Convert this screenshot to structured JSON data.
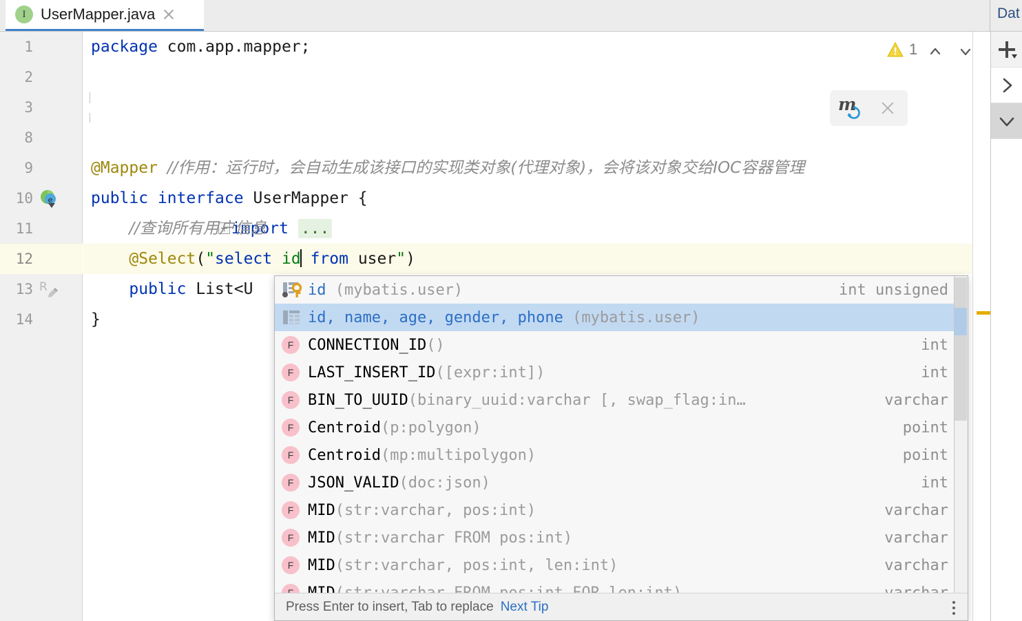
{
  "window": {
    "tab": {
      "icon": "java-interface-icon",
      "title": "UserMapper.java",
      "close_label": "×"
    },
    "right_panel_tab": "Dat"
  },
  "inspection": {
    "warning_icon": "warning-triangle-icon",
    "warning_count": "1",
    "prev_label": "˄",
    "next_label": "˅"
  },
  "mybatis_hint": {
    "logo": "mybatis-logo-icon",
    "close_label": "×"
  },
  "toolstrip": {
    "buttons": [
      {
        "name": "add-button",
        "glyph": "+"
      },
      {
        "name": "expand-right-button",
        "glyph": "›"
      },
      {
        "name": "collapse-down-button",
        "glyph": "⌄"
      }
    ]
  },
  "editor": {
    "lines": [
      {
        "num": "1",
        "marker": "",
        "highlight": false
      },
      {
        "num": "2",
        "marker": "",
        "highlight": false
      },
      {
        "num": "3",
        "marker": "",
        "highlight": false
      },
      {
        "num": "8",
        "marker": "",
        "highlight": false
      },
      {
        "num": "9",
        "marker": "",
        "highlight": false
      },
      {
        "num": "10",
        "marker": "implemented-interface-icon",
        "highlight": false
      },
      {
        "num": "11",
        "marker": "",
        "highlight": false
      },
      {
        "num": "12",
        "marker": "",
        "highlight": true
      },
      {
        "num": "13",
        "marker": "recorder-edit-icon",
        "highlight": false
      },
      {
        "num": "14",
        "marker": "",
        "highlight": false
      }
    ],
    "code": {
      "l1_kw": "package",
      "l1_rest": " com.app.mapper;",
      "l3_kw": "import",
      "l3_fold": "...",
      "l9_anno": "@Mapper",
      "l9_comment": "//作用：运行时，会自动生成该接口的实现类对象(代理对象)，会将该对象交给IOC容器管理",
      "l10_kw1": "public",
      "l10_kw2": "interface",
      "l10_name": "UserMapper",
      "l10_brace": "{",
      "l11_comment": "//查询所有用户信息",
      "l12_anno": "@Select",
      "l12_open": "(",
      "l12_q1": "\"",
      "l12_sel": "select",
      "l12_col": "id",
      "l12_from": "from",
      "l12_tbl": "user",
      "l12_q2": "\"",
      "l12_close": ")",
      "l13_kw": "public",
      "l13_rest": "List<U",
      "l14_brace": "}"
    }
  },
  "completion": {
    "items": [
      {
        "icon": "db-column-primary-key-icon",
        "name": "id",
        "args": "",
        "suffix": " (mybatis.user)",
        "type": "int unsigned",
        "selected": false
      },
      {
        "icon": "db-table-icon",
        "name": "id, name, age, gender, phone",
        "args": "",
        "suffix": " (mybatis.user)",
        "type": "",
        "selected": true
      },
      {
        "icon": "sql-function-icon",
        "name": "CONNECTION_ID",
        "args": "()",
        "suffix": "",
        "type": "int",
        "selected": false
      },
      {
        "icon": "sql-function-icon",
        "name": "LAST_INSERT_ID",
        "args": "([expr:int])",
        "suffix": "",
        "type": "int",
        "selected": false
      },
      {
        "icon": "sql-function-icon",
        "name": "BIN_TO_UUID",
        "args": "(binary_uuid:varchar [, swap_flag:in…",
        "suffix": "",
        "type": "varchar",
        "selected": false
      },
      {
        "icon": "sql-function-icon",
        "name": "Centroid",
        "args": "(p:polygon)",
        "suffix": "",
        "type": "point",
        "selected": false
      },
      {
        "icon": "sql-function-icon",
        "name": "Centroid",
        "args": "(mp:multipolygon)",
        "suffix": "",
        "type": "point",
        "selected": false
      },
      {
        "icon": "sql-function-icon",
        "name": "JSON_VALID",
        "args": "(doc:json)",
        "suffix": "",
        "type": "int",
        "selected": false
      },
      {
        "icon": "sql-function-icon",
        "name": "MID",
        "args": "(str:varchar, pos:int)",
        "suffix": "",
        "type": "varchar",
        "selected": false
      },
      {
        "icon": "sql-function-icon",
        "name": "MID",
        "args": "(str:varchar FROM pos:int)",
        "suffix": "",
        "type": "varchar",
        "selected": false
      },
      {
        "icon": "sql-function-icon",
        "name": "MID",
        "args": "(str:varchar, pos:int, len:int)",
        "suffix": "",
        "type": "varchar",
        "selected": false
      },
      {
        "icon": "sql-function-icon",
        "name": "MID",
        "args": "(str:varchar FROM pos:int FOR len:int)",
        "suffix": "",
        "type": "varchar",
        "selected": false
      }
    ],
    "status": {
      "hint": "Press Enter to insert, Tab to replace",
      "link": "Next Tip",
      "more_label": "more-options-icon"
    }
  },
  "colors": {
    "tab_underline": "#4083c9",
    "selection": "#c2d9f2",
    "current_line": "#fcfae8",
    "keyword": "#0033b3",
    "string": "#067d17",
    "annotation": "#9e880d",
    "comment": "#8c8c8c",
    "warning": "#e6ac00",
    "link": "#2b6fc4"
  }
}
